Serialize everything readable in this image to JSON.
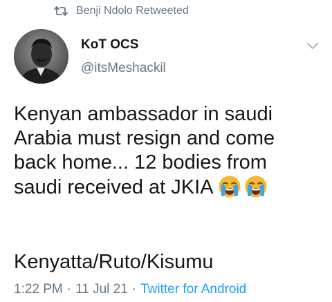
{
  "retweet": {
    "label": "Benji Ndolo Retweeted",
    "icon": "retweet-icon"
  },
  "author": {
    "display_name": "KoT OCS",
    "handle": "@itsMeshackil",
    "avatar_icon": "avatar-portrait"
  },
  "menu": {
    "icon": "chevron-down-icon"
  },
  "tweet": {
    "lines": [
      "Kenyan ambassador in saudi",
      "Arabia  must resign and come",
      "back home... 12 bodies from",
      "saudi received at JKIA"
    ],
    "emojis": [
      "crying-face-emoji",
      "crying-face-emoji"
    ],
    "hashtags_line": "Kenyatta/Ruto/Kisumu"
  },
  "meta": {
    "time": "1:22 PM",
    "separator": "·",
    "date": "11 Jul 21",
    "source": "Twitter for Android"
  },
  "colors": {
    "text": "#14171a",
    "secondary": "#657786",
    "link": "#1da1f2",
    "emoji_face": "#f7b733",
    "tears": "#3ba3e8"
  }
}
